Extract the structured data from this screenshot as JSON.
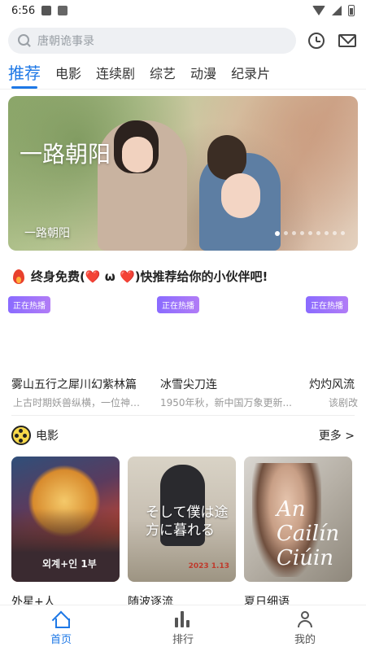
{
  "status_bar": {
    "time": "6:56"
  },
  "search": {
    "placeholder": "唐朝诡事录"
  },
  "tabs": [
    {
      "label": "推荐",
      "active": true
    },
    {
      "label": "电影"
    },
    {
      "label": "连续剧"
    },
    {
      "label": "综艺"
    },
    {
      "label": "动漫"
    },
    {
      "label": "纪录片"
    }
  ],
  "banner": {
    "title": "一路朝阳",
    "caption": "一路朝阳",
    "dot_count": 9,
    "active_dot": 0
  },
  "promo": {
    "text": "终身免费(❤️ ω ❤️)快推荐给你的小伙伴吧!"
  },
  "hot": {
    "badge": "正在热播",
    "items": [
      {
        "title": "雾山五行之犀川幻紫林篇",
        "desc": "上古时期妖兽纵横，一位神秘..."
      },
      {
        "title": "冰雪尖刀连",
        "desc": "1950年秋，新中国万象更新..."
      },
      {
        "title": "灼灼风流",
        "desc": "该剧改"
      }
    ]
  },
  "movies_section": {
    "title": "电影",
    "more": "更多 >",
    "items": [
      {
        "name": "外星+人",
        "poster_text": "외계+인 1부"
      },
      {
        "name": "随波逐流",
        "poster_text": "そして僕は途方に暮れる",
        "poster_date": "2023 1.13"
      },
      {
        "name": "夏日细语",
        "poster_text": "An Cailín Ciúin"
      }
    ]
  },
  "bottom_nav": [
    {
      "label": "首页",
      "active": true
    },
    {
      "label": "排行"
    },
    {
      "label": "我的"
    }
  ],
  "colors": {
    "accent": "#1e78e6",
    "badge": "#8a6bff"
  }
}
